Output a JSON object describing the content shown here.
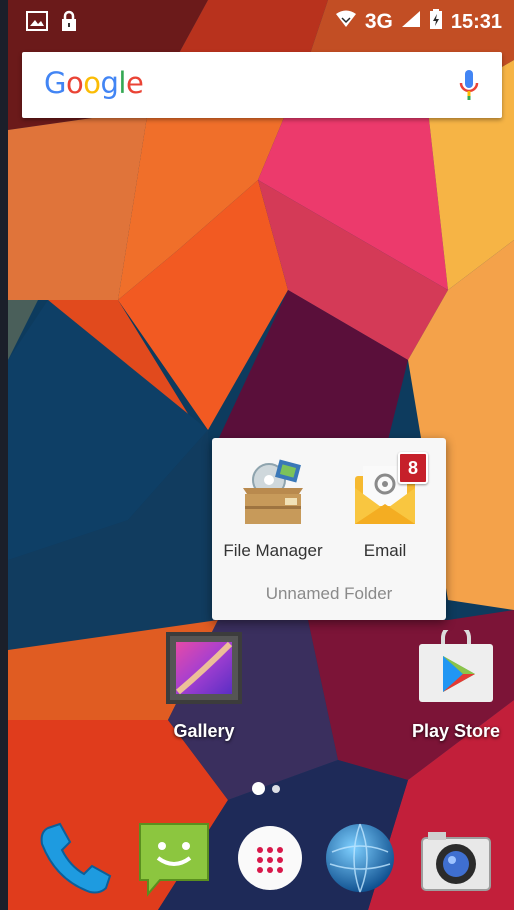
{
  "statusbar": {
    "icons_left": [
      "image-notification-icon",
      "lock-icon"
    ],
    "network": "3G",
    "time": "15:31",
    "icons_right": [
      "wifi-icon",
      "signal-icon",
      "battery-icon"
    ]
  },
  "search": {
    "logo_text": "Google",
    "mic_icon": "mic-icon"
  },
  "folder": {
    "name": "Unnamed Folder",
    "apps": [
      {
        "label": "File Manager",
        "icon": "file-manager-icon"
      },
      {
        "label": "Email",
        "icon": "email-icon",
        "badge": "8"
      }
    ]
  },
  "home_apps": [
    {
      "label": "Gallery",
      "icon": "gallery-icon"
    },
    {
      "label": "Play Store",
      "icon": "play-store-icon"
    }
  ],
  "page_indicator": {
    "pages": 2,
    "current": 1
  },
  "dock": [
    {
      "icon": "phone-icon"
    },
    {
      "icon": "messaging-icon"
    },
    {
      "icon": "app-drawer-icon"
    },
    {
      "icon": "browser-icon"
    },
    {
      "icon": "camera-icon"
    }
  ],
  "colors": {
    "google_blue": "#4285F4",
    "google_red": "#EA4335",
    "google_yellow": "#FBBC05",
    "google_green": "#34A853",
    "badge_red": "#C6202A"
  }
}
